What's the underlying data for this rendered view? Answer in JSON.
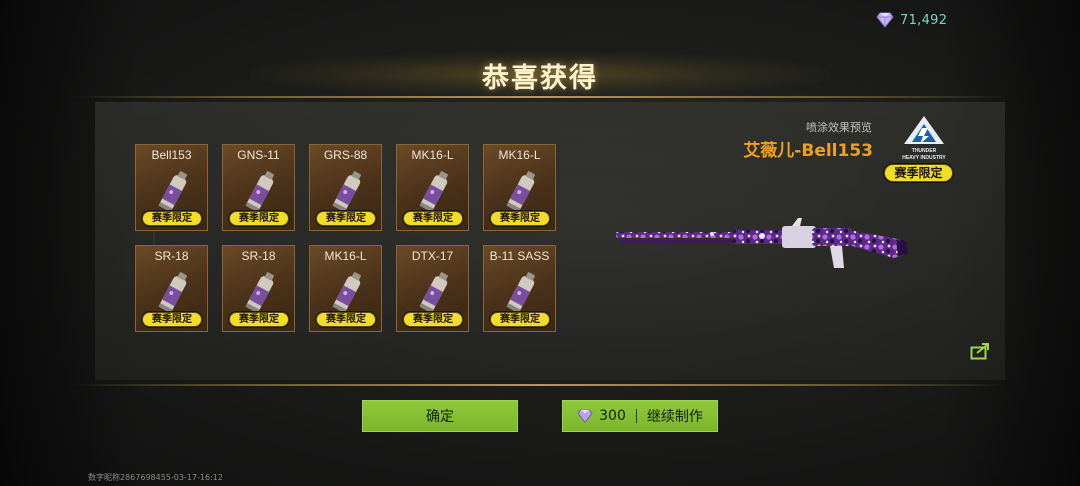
{
  "currency": {
    "icon": "gem-icon",
    "amount": "71,492"
  },
  "title": "恭喜获得",
  "rewards": [
    {
      "name": "Bell153",
      "badge": "赛季限定"
    },
    {
      "name": "GNS-11",
      "badge": "赛季限定"
    },
    {
      "name": "GRS-88",
      "badge": "赛季限定"
    },
    {
      "name": "MK16-L",
      "badge": "赛季限定"
    },
    {
      "name": "MK16-L",
      "badge": "赛季限定"
    },
    {
      "name": "SR-18",
      "badge": "赛季限定"
    },
    {
      "name": "SR-18",
      "badge": "赛季限定"
    },
    {
      "name": "MK16-L",
      "badge": "赛季限定"
    },
    {
      "name": "DTX-17",
      "badge": "赛季限定"
    },
    {
      "name": "B-11 SASS",
      "badge": "赛季限定"
    }
  ],
  "preview": {
    "label": "喷涂效果预览",
    "skin_name": "艾薇儿-Bell153",
    "brand_badge": "赛季限定",
    "brand_lines": [
      "THUNDER",
      "HEAVY INDUSTRY"
    ]
  },
  "buttons": {
    "confirm": "确定",
    "continue_cost": "300",
    "continue_label": "继续制作"
  },
  "footer": {
    "id_text": "数字昵称2867698455-03-17-16:12"
  },
  "colors": {
    "accent_green": "#8fc93a",
    "badge_yellow": "#f2dc2a",
    "skin_orange": "#f0a020",
    "card_brown": "#4a3119"
  }
}
